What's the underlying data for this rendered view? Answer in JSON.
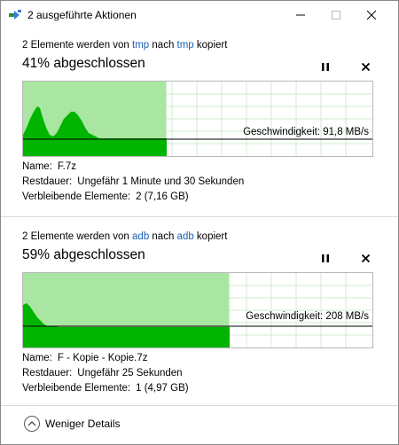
{
  "window": {
    "title": "2 ausgeführte Aktionen",
    "app_icon": "copy-arrow-icon",
    "buttons": [
      "minimize-icon",
      "maximize-icon",
      "close-icon"
    ]
  },
  "operations": [
    {
      "header_prefix": "2 Elemente werden von ",
      "source": "tmp",
      "header_middle": " nach ",
      "target": "tmp",
      "header_suffix": " kopiert",
      "progress_text": "41% abgeschlossen",
      "progress_percent": 41,
      "speed_text": "Geschwindigkeit: 91,8 MB/s",
      "name_label": "Name:",
      "name_value": "F.7z",
      "remaining_label": "Restdauer:",
      "remaining_value": "Ungefähr 1 Minute und 30 Sekunden",
      "items_label": "Verbleibende Elemente:",
      "items_value": "2 (7,16 GB)"
    },
    {
      "header_prefix": "2 Elemente werden von ",
      "source": "adb",
      "header_middle": " nach ",
      "target": "adb",
      "header_suffix": " kopiert",
      "progress_text": "59% abgeschlossen",
      "progress_percent": 59,
      "speed_text": "Geschwindigkeit: 208 MB/s",
      "name_label": "Name:",
      "name_value": "F - Kopie - Kopie.7z",
      "remaining_label": "Restdauer:",
      "remaining_value": "Ungefähr 25 Sekunden",
      "items_label": "Verbleibende Elemente:",
      "items_value": "1 (4,97 GB)"
    }
  ],
  "footer": {
    "label": "Weniger Details",
    "icon": "chevron-up-circle-icon"
  },
  "colors": {
    "progress_fill": "#a8e6a1",
    "speed_fill": "#00b400",
    "grid": "#cfeecf",
    "link": "#1a5fb4"
  }
}
